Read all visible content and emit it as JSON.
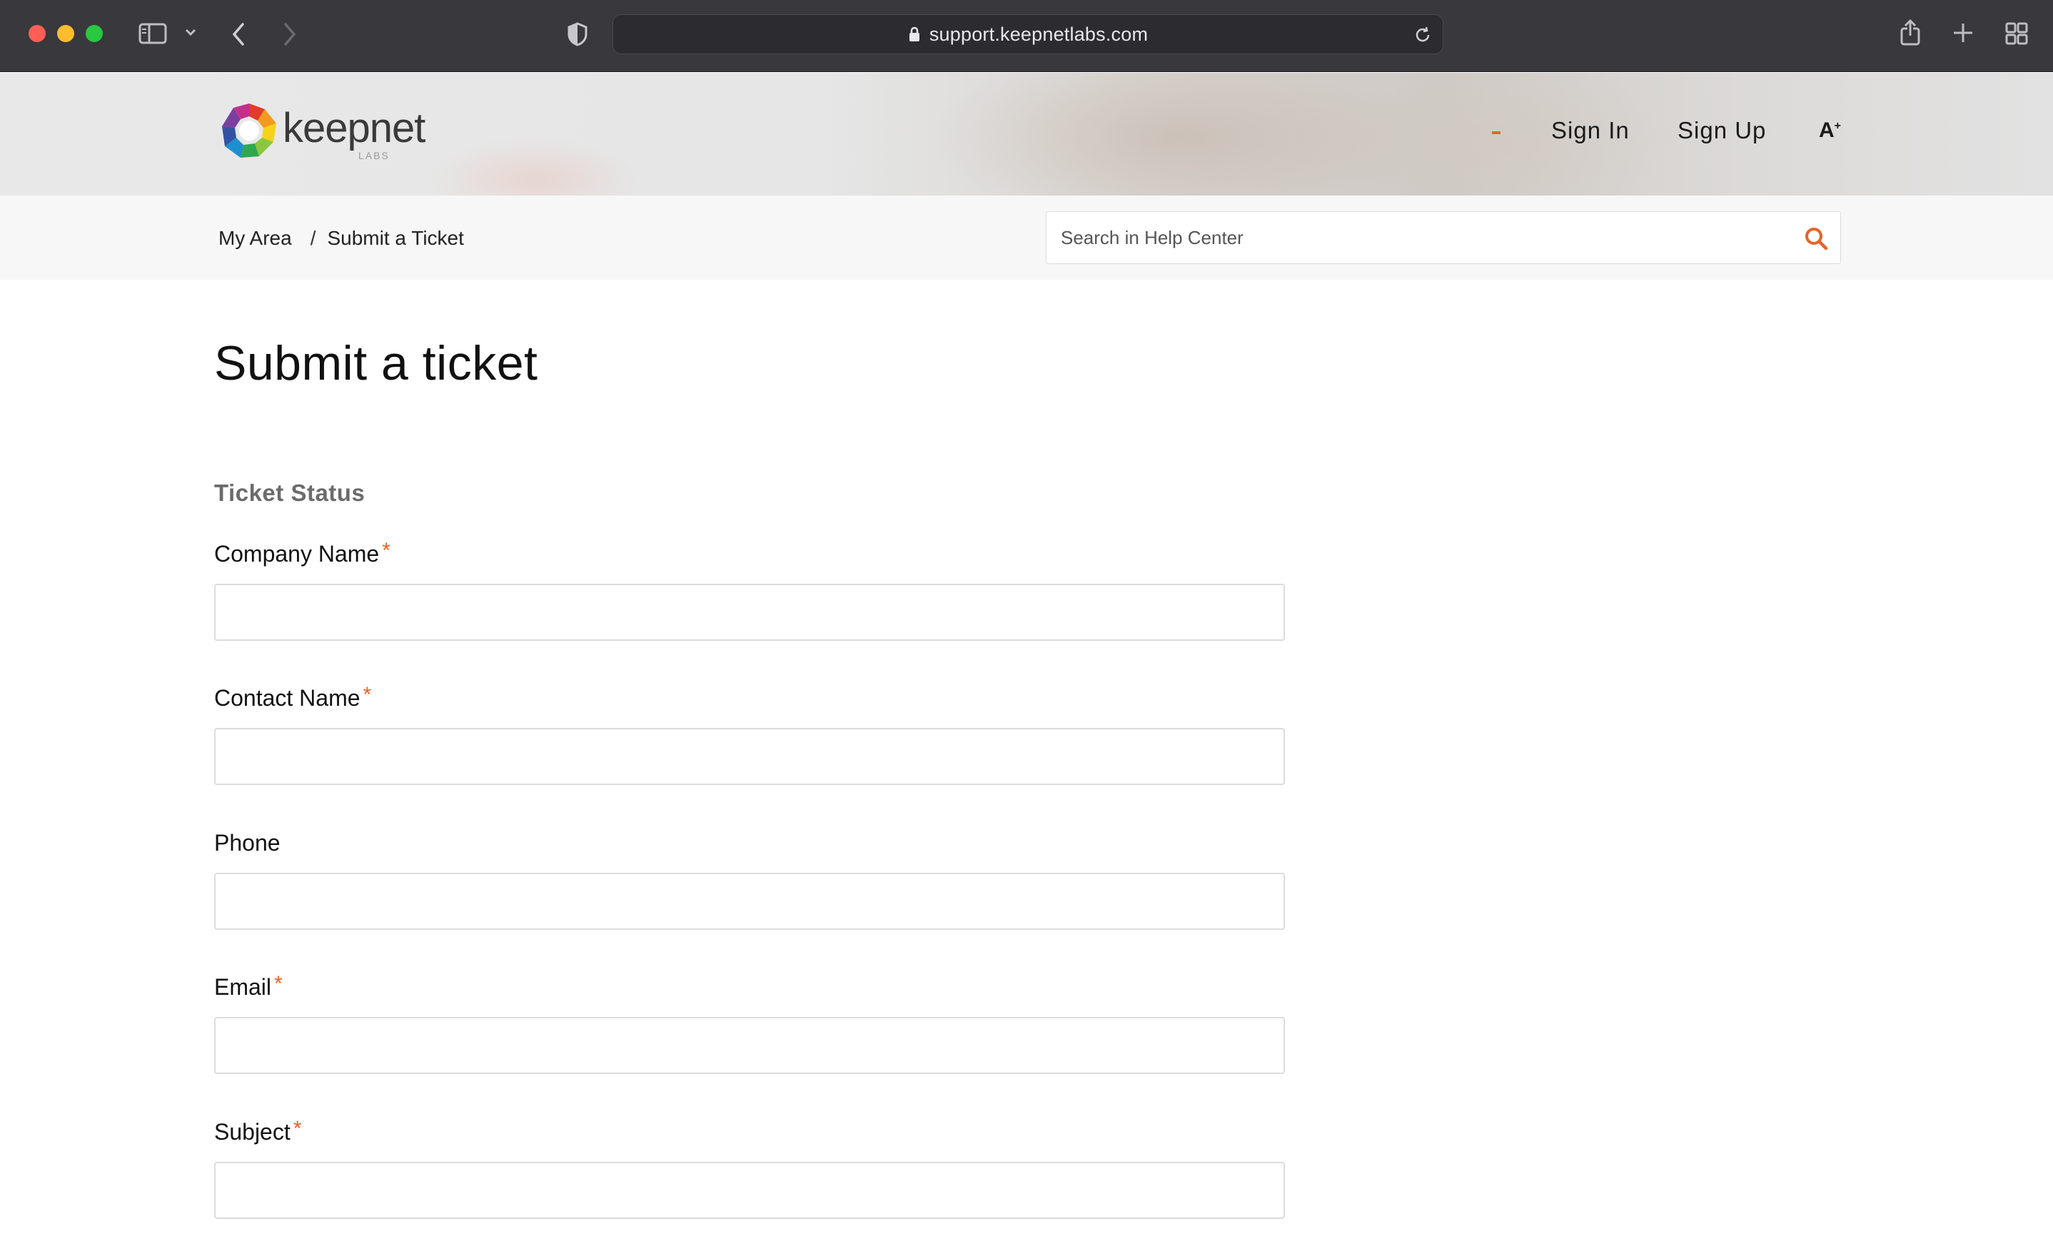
{
  "browser": {
    "url": "support.keepnetlabs.com"
  },
  "header": {
    "logo_text": "keepnet",
    "logo_sub": "LABS",
    "nav_signin": "Sign In",
    "nav_signup": "Sign Up",
    "font_toggle": "A",
    "font_toggle_sup": "+"
  },
  "breadcrumb": {
    "items": [
      "My Area",
      "Submit a Ticket"
    ],
    "separator": "/"
  },
  "search": {
    "placeholder": "Search in Help Center"
  },
  "main": {
    "title": "Submit a ticket",
    "section_title": "Ticket Status"
  },
  "form": {
    "fields": [
      {
        "label": "Company Name",
        "required_mark": "*",
        "value": ""
      },
      {
        "label": "Contact Name",
        "required_mark": "*",
        "value": ""
      },
      {
        "label": "Phone",
        "required_mark": "",
        "value": ""
      },
      {
        "label": "Email",
        "required_mark": "*",
        "value": ""
      },
      {
        "label": "Subject",
        "required_mark": "*",
        "value": ""
      }
    ]
  },
  "colors": {
    "accent": "#e8622a",
    "chrome_bg": "#38383d"
  }
}
